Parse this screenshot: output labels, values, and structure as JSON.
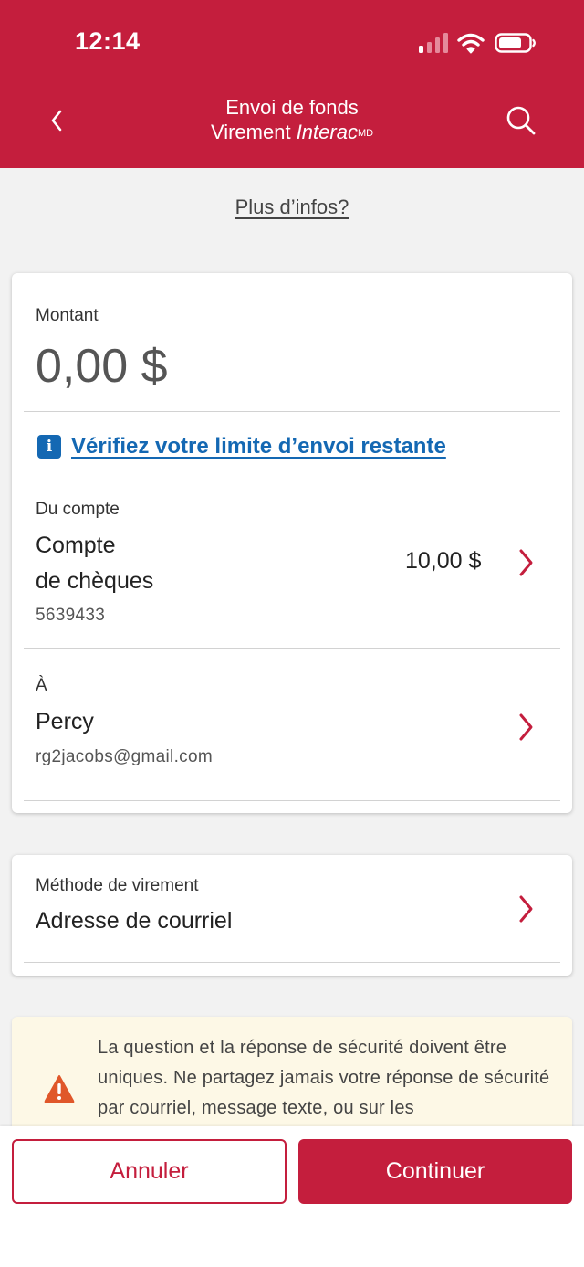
{
  "status_bar": {
    "time": "12:14"
  },
  "header": {
    "title_line1": "Envoi de fonds",
    "title_line2_prefix": "Virement ",
    "title_line2_brand": "Interac",
    "title_line2_sup": "MD"
  },
  "more_info_link": "Plus d’infos?",
  "amount": {
    "label": "Montant",
    "value": "0,00 $"
  },
  "limit_link": "Vérifiez votre limite d’envoi restante",
  "from_account": {
    "label": "Du compte",
    "name_line1": "Compte",
    "name_line2": "de chèques",
    "number": "5639433",
    "balance": "10,00 $"
  },
  "recipient": {
    "label": "À",
    "name": "Percy",
    "email": "rg2jacobs@gmail.com"
  },
  "transfer_method": {
    "label": "Méthode de virement",
    "value": "Adresse de courriel"
  },
  "warning": {
    "text": "La question et la réponse de sécurité doivent être uniques. Ne partagez jamais votre réponse de sécurité par courriel, message texte, ou sur les"
  },
  "buttons": {
    "cancel": "Annuler",
    "continue": "Continuer"
  },
  "colors": {
    "brand": "#c41e3d",
    "link": "#1468b3",
    "warning_bg": "#fdf8e6",
    "warning_icon": "#e0572a"
  },
  "icons": [
    "chevron-left-icon",
    "search-icon",
    "info-icon",
    "chevron-right-icon",
    "warning-icon",
    "wifi-icon",
    "battery-icon",
    "signal-icon"
  ]
}
